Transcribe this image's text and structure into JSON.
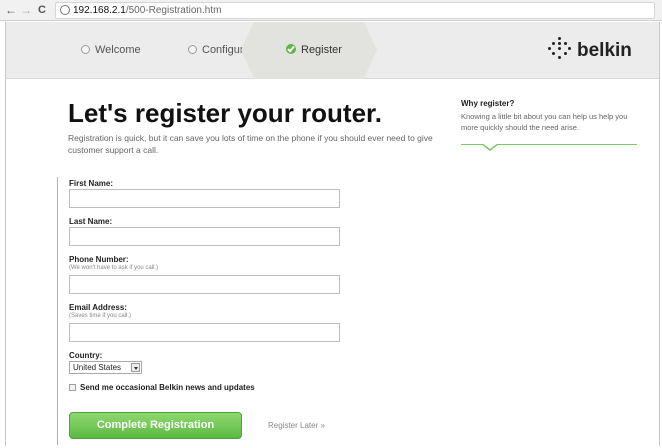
{
  "browser": {
    "back": "←",
    "forward": "→",
    "reload": "C",
    "url_host": "192.168.2.1",
    "url_path": "/500-Registration.htm"
  },
  "steps": [
    {
      "label": "Welcome",
      "state": "inactive"
    },
    {
      "label": "Configure",
      "state": "inactive"
    },
    {
      "label": "Register",
      "state": "active"
    }
  ],
  "brand": {
    "name": "belkin",
    "accent": "#5db544"
  },
  "main": {
    "title": "Let's register your router.",
    "subtitle": "Registration is quick, but it can save you lots of time on the phone if you should ever need to give customer support a call."
  },
  "sidebar": {
    "title": "Why register?",
    "text": "Knowing a little bit about you can help us help you more quickly should the need arise."
  },
  "form": {
    "first_name": {
      "label": "First Name:",
      "value": ""
    },
    "last_name": {
      "label": "Last Name:",
      "value": ""
    },
    "phone": {
      "label": "Phone Number:",
      "hint": "(We won't have to ask if you call.)",
      "value": ""
    },
    "email": {
      "label": "Email Address:",
      "hint": "(Saves time if you call.)",
      "value": ""
    },
    "country": {
      "label": "Country:",
      "selected": "United States"
    },
    "newsletter": {
      "label": "Send me occasional Belkin news and updates",
      "checked": false
    },
    "submit_label": "Complete Registration",
    "later_label": "Register Later »"
  }
}
